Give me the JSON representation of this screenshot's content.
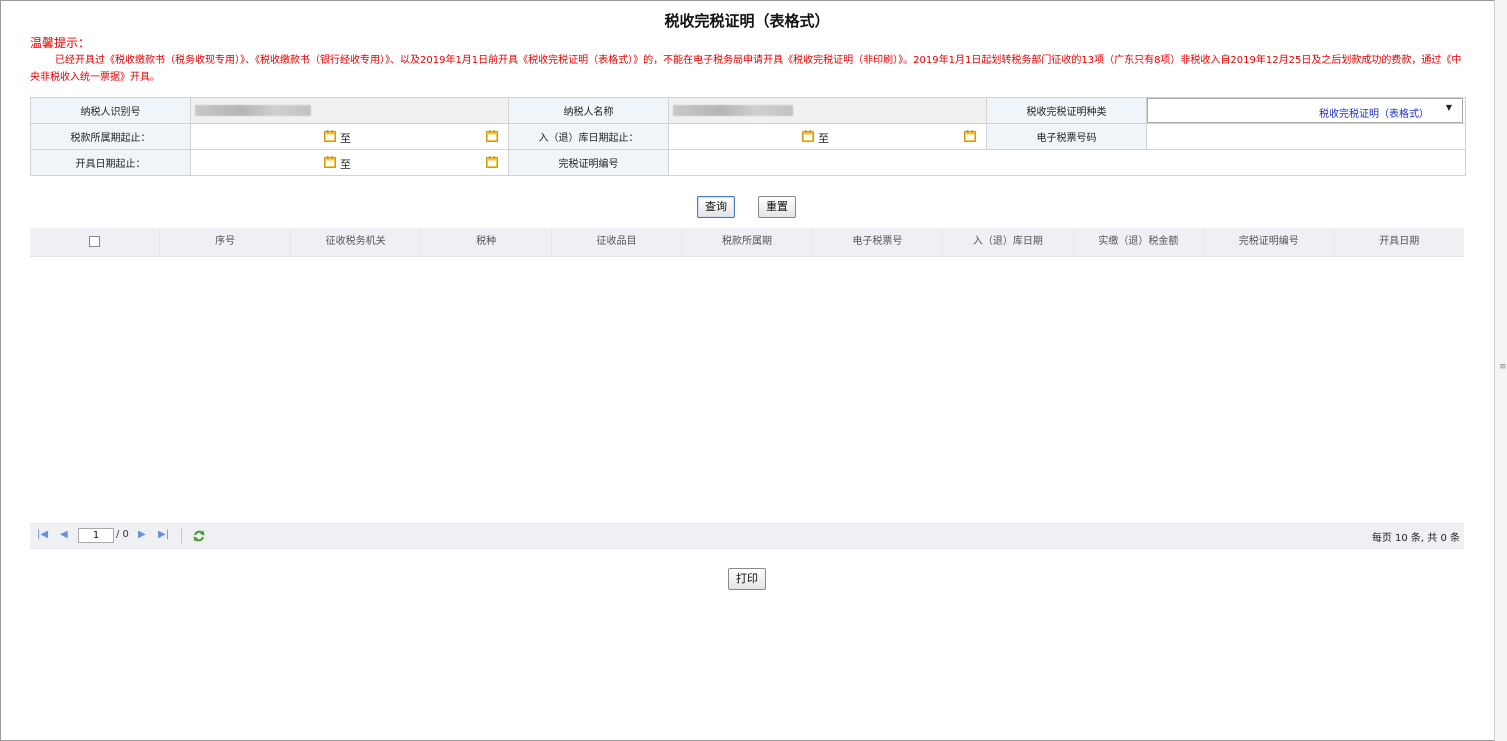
{
  "page": {
    "title": "税收完税证明（表格式）",
    "notice_heading": "温馨提示：",
    "notice_text": "已经开具过《税收缴款书（税务收现专用）》、《税收缴款书（银行经收专用）》、以及2019年1月1日前开具《税收完税证明（表格式）》的，不能在电子税务局申请开具《税收完税证明（非印刷）》。2019年1月1日起划转税务部门征收的13项（广东只有8项）非税收入自2019年12月25日及之后划款成功的费款，通过《中央非税收入统一票据》开具。"
  },
  "form": {
    "taxpayer_id_label": "纳税人识别号",
    "taxpayer_name_label": "纳税人名称",
    "cert_type_label": "税收完税证明种类",
    "cert_type_value": "税收完税证明（表格式）",
    "tax_period_label": "税款所属期起止：",
    "in_out_date_label": "入（退）库日期起止：",
    "e_ticket_label": "电子税票号码",
    "issue_date_label": "开具日期起止：",
    "cert_no_label": "完税证明编号",
    "to_text": "至"
  },
  "buttons": {
    "query": "查询",
    "reset": "重置",
    "print": "打印"
  },
  "grid": {
    "columns": [
      "序号",
      "征收税务机关",
      "税种",
      "征收品目",
      "税款所属期",
      "电子税票号",
      "入（退）库日期",
      "实缴（退）税金额",
      "完税证明编号",
      "开具日期"
    ]
  },
  "pager": {
    "page_value": "1",
    "total_pages": "/ 0",
    "info": "每页 10 条, 共 0 条"
  },
  "colors": {
    "notice": "#e60000",
    "select_value": "#1c30c8",
    "label_bg": "#f0f5f9"
  },
  "icons": [
    "calendar-icon",
    "first-page-icon",
    "prev-page-icon",
    "next-page-icon",
    "last-page-icon",
    "refresh-icon",
    "dropdown-arrow-icon",
    "checkbox-icon"
  ]
}
